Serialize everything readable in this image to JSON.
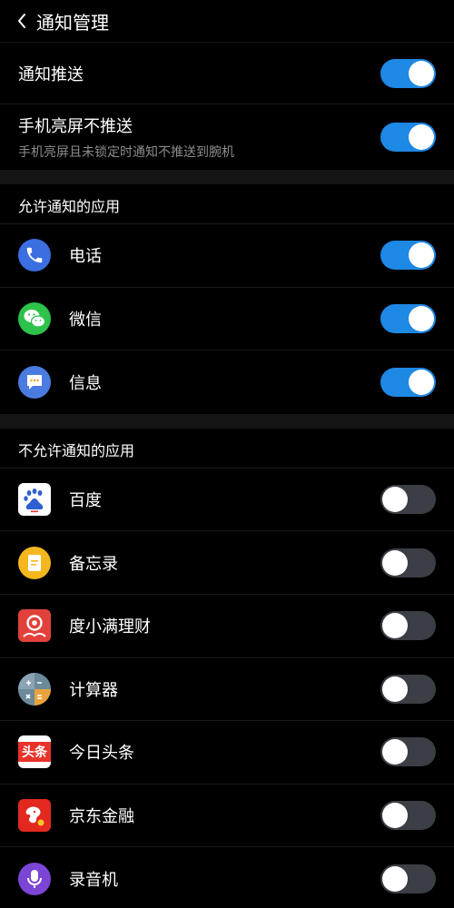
{
  "header": {
    "title": "通知管理"
  },
  "settings": {
    "push": {
      "label": "通知推送",
      "enabled": true
    },
    "screen_on": {
      "label": "手机亮屏不推送",
      "description": "手机亮屏且未锁定时通知不推送到腕机",
      "enabled": true
    }
  },
  "allowed": {
    "title": "允许通知的应用",
    "apps": [
      {
        "name": "电话",
        "icon": "phone-icon",
        "enabled": true
      },
      {
        "name": "微信",
        "icon": "wechat-icon",
        "enabled": true
      },
      {
        "name": "信息",
        "icon": "messages-icon",
        "enabled": true
      }
    ]
  },
  "disallowed": {
    "title": "不允许通知的应用",
    "apps": [
      {
        "name": "百度",
        "icon": "baidu-icon",
        "enabled": false
      },
      {
        "name": "备忘录",
        "icon": "memo-icon",
        "enabled": false
      },
      {
        "name": "度小满理财",
        "icon": "duxiaoman-icon",
        "enabled": false
      },
      {
        "name": "计算器",
        "icon": "calculator-icon",
        "enabled": false
      },
      {
        "name": "今日头条",
        "icon": "toutiao-icon",
        "enabled": false,
        "icon_text": "头条"
      },
      {
        "name": "京东金融",
        "icon": "jd-finance-icon",
        "enabled": false
      },
      {
        "name": "录音机",
        "icon": "recorder-icon",
        "enabled": false
      }
    ]
  },
  "colors": {
    "toggle_on": "#1e88e5",
    "toggle_off": "#3b3e44",
    "background": "#000000"
  }
}
